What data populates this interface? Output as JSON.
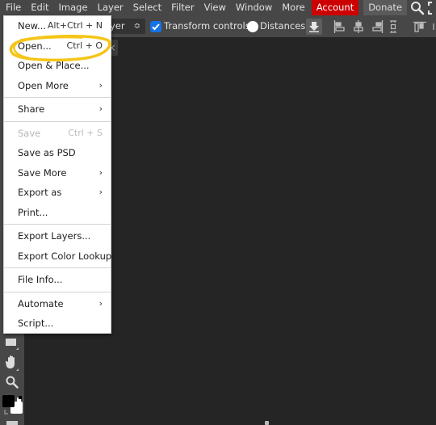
{
  "menubar": {
    "items": [
      "File",
      "Edit",
      "Image",
      "Layer",
      "Select",
      "Filter",
      "View",
      "Window",
      "More"
    ],
    "account_label": "Account",
    "donate_label": "Donate",
    "account_color": "#cc0000",
    "icons": [
      "search-icon",
      "fullscreen-icon"
    ]
  },
  "optionsbar": {
    "layer_select_value": "Layer",
    "layer_select_visible_text": "yer",
    "transform_controls_label": "Transform controls",
    "transform_controls_checked": true,
    "distances_label": "Distances",
    "distances_checked": false,
    "icons": [
      "download-icon",
      "align-left-icon",
      "align-center-h-icon",
      "align-right-icon",
      "distribute-h-icon",
      "align-top-icon"
    ]
  },
  "file_menu": {
    "groups": [
      [
        {
          "label": "New...",
          "shortcut": "Alt+Ctrl + N",
          "submenu": false,
          "disabled": false
        },
        {
          "label": "Open...",
          "shortcut": "Ctrl + O",
          "submenu": false,
          "disabled": false,
          "highlighted_annotation": true
        },
        {
          "label": "Open & Place...",
          "shortcut": "",
          "submenu": false,
          "disabled": false
        },
        {
          "label": "Open More",
          "shortcut": "",
          "submenu": true,
          "disabled": false
        }
      ],
      [
        {
          "label": "Share",
          "shortcut": "",
          "submenu": true,
          "disabled": false
        }
      ],
      [
        {
          "label": "Save",
          "shortcut": "Ctrl + S",
          "submenu": false,
          "disabled": true
        },
        {
          "label": "Save as PSD",
          "shortcut": "",
          "submenu": false,
          "disabled": false
        },
        {
          "label": "Save More",
          "shortcut": "",
          "submenu": true,
          "disabled": false
        },
        {
          "label": "Export as",
          "shortcut": "",
          "submenu": true,
          "disabled": false
        },
        {
          "label": "Print...",
          "shortcut": "",
          "submenu": false,
          "disabled": false
        }
      ],
      [
        {
          "label": "Export Layers...",
          "shortcut": "",
          "submenu": false,
          "disabled": false
        },
        {
          "label": "Export Color Lookup...",
          "shortcut": "",
          "submenu": false,
          "disabled": false
        }
      ],
      [
        {
          "label": "File Info...",
          "shortcut": "",
          "submenu": false,
          "disabled": false
        }
      ],
      [
        {
          "label": "Automate",
          "shortcut": "",
          "submenu": true,
          "disabled": false
        },
        {
          "label": "Script...",
          "shortcut": "",
          "submenu": false,
          "disabled": false
        }
      ]
    ],
    "submenu_glyph": "›"
  },
  "document_tab": {
    "close_glyph": "×"
  },
  "toolbar": {
    "tools": [
      "rectangle-shape-tool",
      "hand-tool",
      "zoom-tool",
      "color-swatches"
    ],
    "foreground_color": "#000000",
    "background_color": "#ffffff"
  },
  "colors": {
    "accent": "#1473e6",
    "annotation": "#f5c518"
  }
}
